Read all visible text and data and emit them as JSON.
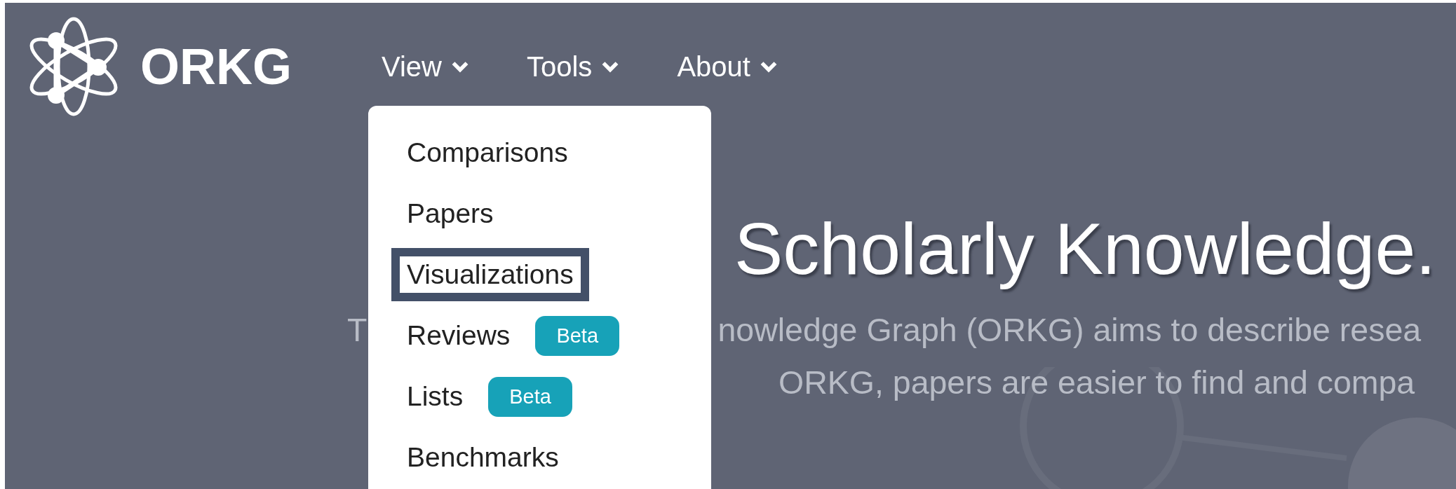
{
  "brand": {
    "name": "ORKG"
  },
  "nav": [
    {
      "label": "View",
      "menu": {
        "items": [
          {
            "label": "Comparisons",
            "focused": false
          },
          {
            "label": "Papers",
            "focused": false
          },
          {
            "label": "Visualizations",
            "focused": true
          },
          {
            "label": "Reviews",
            "focused": false,
            "badge": "Beta"
          },
          {
            "label": "Lists",
            "focused": false,
            "badge": "Beta"
          },
          {
            "label": "Benchmarks",
            "focused": false
          }
        ]
      }
    },
    {
      "label": "Tools"
    },
    {
      "label": "About"
    }
  ],
  "hero": {
    "title": "Scholarly Knowledge.",
    "description_lines": [
      {
        "segments": [
          "T",
          "nowledge Graph (ORKG) aims to describe resea"
        ]
      },
      {
        "segments": [
          "ORKG, papers are easier to find and compa"
        ]
      }
    ]
  }
}
